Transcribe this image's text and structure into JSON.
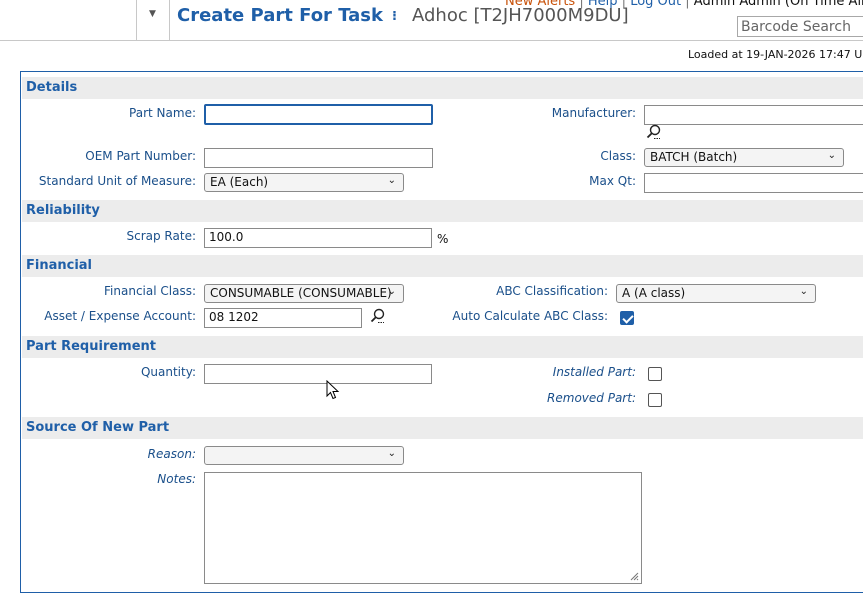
{
  "header": {
    "title": "Create Part For Task",
    "separator": "⁝",
    "subtitle": "Adhoc [T2JH7000M9DU]",
    "links": {
      "alerts": "New Alerts",
      "sep1": "|",
      "help": "Help",
      "sep2": "|",
      "logout": "Log Out",
      "sep3": "|",
      "user": "Admin Admin (On Time Airlin"
    },
    "barcode_placeholder": "Barcode Search",
    "loaded": "Loaded at 19-JAN-2026 17:47 U"
  },
  "sections": {
    "details": "Details",
    "reliability": "Reliability",
    "financial": "Financial",
    "requirement": "Part Requirement",
    "source": "Source Of New Part"
  },
  "details": {
    "part_name_label": "Part Name:",
    "part_name_value": "",
    "manufacturer_label": "Manufacturer:",
    "manufacturer_value": "",
    "oem_label": "OEM Part Number:",
    "oem_value": "",
    "class_label": "Class:",
    "class_value": "BATCH (Batch)",
    "uom_label": "Standard Unit of Measure:",
    "uom_value": "EA (Each)",
    "maxqt_label": "Max Qt:",
    "maxqt_value": ""
  },
  "reliability": {
    "scrap_label": "Scrap Rate:",
    "scrap_value": "100.0",
    "scrap_unit": "%"
  },
  "financial": {
    "class_label": "Financial Class:",
    "class_value": "CONSUMABLE (CONSUMABLE)",
    "abc_label": "ABC Classification:",
    "abc_value": "A (A class)",
    "account_label": "Asset / Expense Account:",
    "account_value": "08 1202",
    "auto_abc_label": "Auto Calculate ABC Class:",
    "auto_abc_checked": true
  },
  "requirement": {
    "quantity_label": "Quantity:",
    "quantity_value": "",
    "installed_label": "Installed Part:",
    "installed_checked": false,
    "removed_label": "Removed Part:",
    "removed_checked": false
  },
  "source": {
    "reason_label": "Reason:",
    "reason_value": "",
    "notes_label": "Notes:",
    "notes_value": ""
  },
  "colors": {
    "accent": "#1f5fa8",
    "section_bg": "#ececec",
    "alert": "#c8520a"
  }
}
